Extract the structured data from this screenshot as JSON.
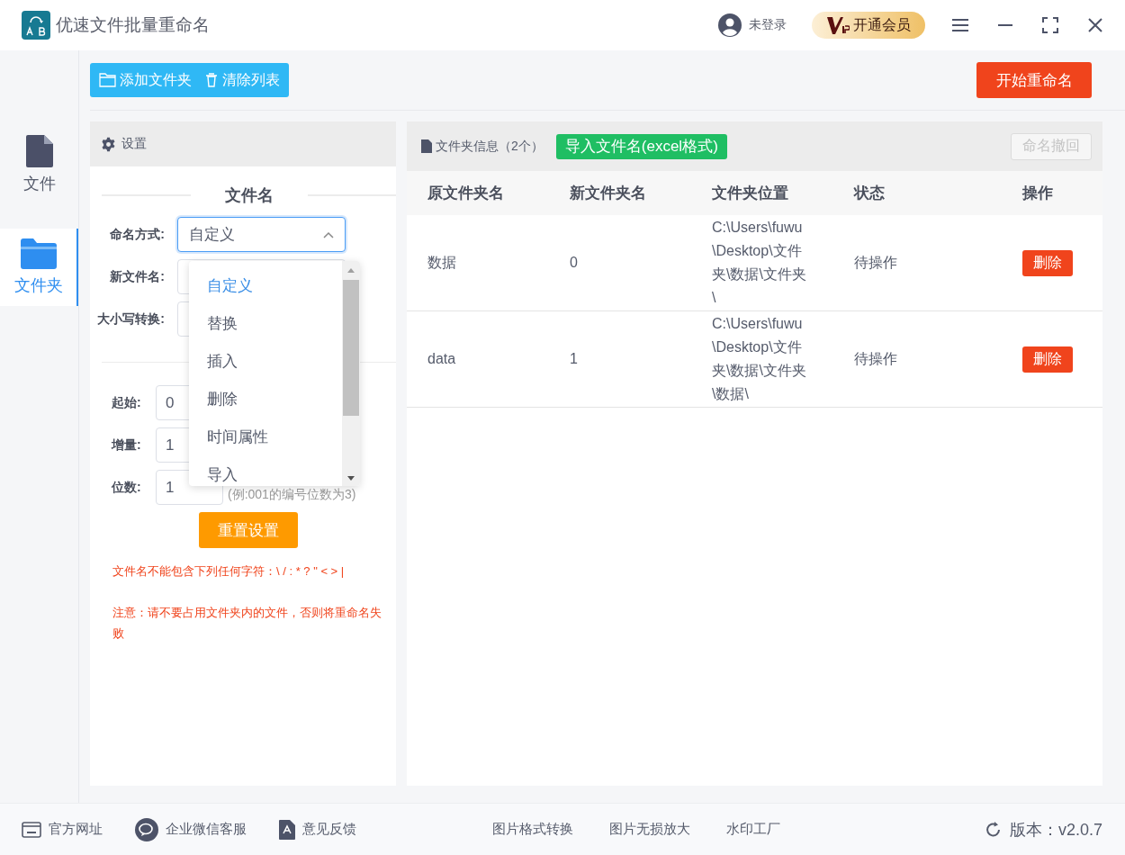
{
  "window": {
    "title": "优速文件批量重命名"
  },
  "header": {
    "user": "未登录",
    "vip": "开通会员"
  },
  "sidebar": {
    "items": [
      {
        "label": "文件",
        "kind": "file",
        "selected": false
      },
      {
        "label": "文件夹",
        "kind": "folder",
        "selected": true
      }
    ]
  },
  "toolbar": {
    "add_folder": "添加文件夹",
    "clear_list": "清除列表",
    "start": "开始重命名"
  },
  "settings": {
    "title": "设置",
    "section": "文件名",
    "naming_mode": {
      "label": "命名方式:",
      "value": "自定义",
      "expanded": true,
      "options": [
        {
          "label": "自定义",
          "selected": true
        },
        {
          "label": "替换",
          "selected": false
        },
        {
          "label": "插入",
          "selected": false
        },
        {
          "label": "删除",
          "selected": false
        },
        {
          "label": "时间属性",
          "selected": false
        },
        {
          "label": "导入",
          "selected": false
        }
      ]
    },
    "new_name": {
      "label": "新文件名:"
    },
    "case": {
      "label": "大小写转换:"
    },
    "start": {
      "label": "起始:",
      "value": "0"
    },
    "step": {
      "label": "增量:",
      "value": "1"
    },
    "digits": {
      "label": "位数:",
      "value": "1",
      "hint": "(例:001的编号位数为3)"
    },
    "reset": "重置设置",
    "warnings": [
      "文件名不能包含下列任何字符：\\ / : * ? \" < > |",
      "注意：请不要占用文件夹内的文件，否则将重命名失败"
    ]
  },
  "table": {
    "title": "文件夹信息（2个）",
    "import_button": "导入文件名(excel格式)",
    "undo_button": {
      "label": "命名撤回",
      "disabled": true
    },
    "columns": [
      "原文件夹名",
      "新文件夹名",
      "文件夹位置",
      "状态",
      "操作"
    ],
    "rows": [
      {
        "original": "数据",
        "new": "0",
        "location": "C:\\Users\\fuwu\\Desktop\\文件夹\\数据\\文件夹\\",
        "status": "待操作",
        "action": "删除"
      },
      {
        "original": "data",
        "new": "1",
        "location": "C:\\Users\\fuwu\\Desktop\\文件夹\\数据\\文件夹\\数据\\",
        "status": "待操作",
        "action": "删除"
      }
    ]
  },
  "footer": {
    "links": [
      {
        "label": "官方网址",
        "kind": "web"
      },
      {
        "label": "企业微信客服",
        "kind": "chat"
      },
      {
        "label": "意见反馈",
        "kind": "feedback"
      }
    ],
    "tools": [
      "图片格式转换",
      "图片无损放大",
      "水印工厂"
    ],
    "version": "版本：v2.0.7"
  }
}
